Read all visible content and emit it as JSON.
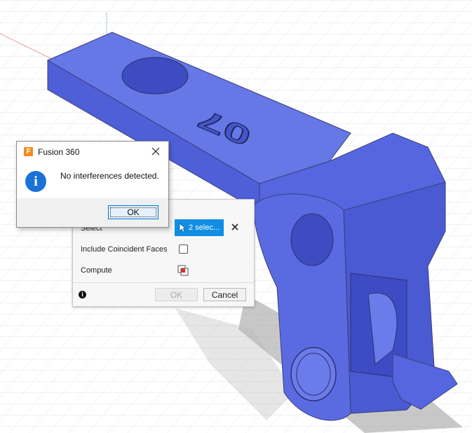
{
  "message_box": {
    "title": "Fusion 360",
    "app_icon_letter": "F",
    "message": "No interferences detected.",
    "ok_label": "OK"
  },
  "interference_panel": {
    "select_label": "Select",
    "select_value": "2 selec...",
    "coincident_label": "Include Coincident Faces",
    "coincident_checked": false,
    "compute_label": "Compute",
    "ok_label": "OK",
    "cancel_label": "Cancel"
  },
  "viewport": {
    "model_text": "07",
    "model_color": "#5b6ee3",
    "background_color": "#ffffff"
  },
  "colors": {
    "accent": "#0f8ee3",
    "info_blue": "#1b72d6",
    "app_orange": "#f28d20"
  }
}
